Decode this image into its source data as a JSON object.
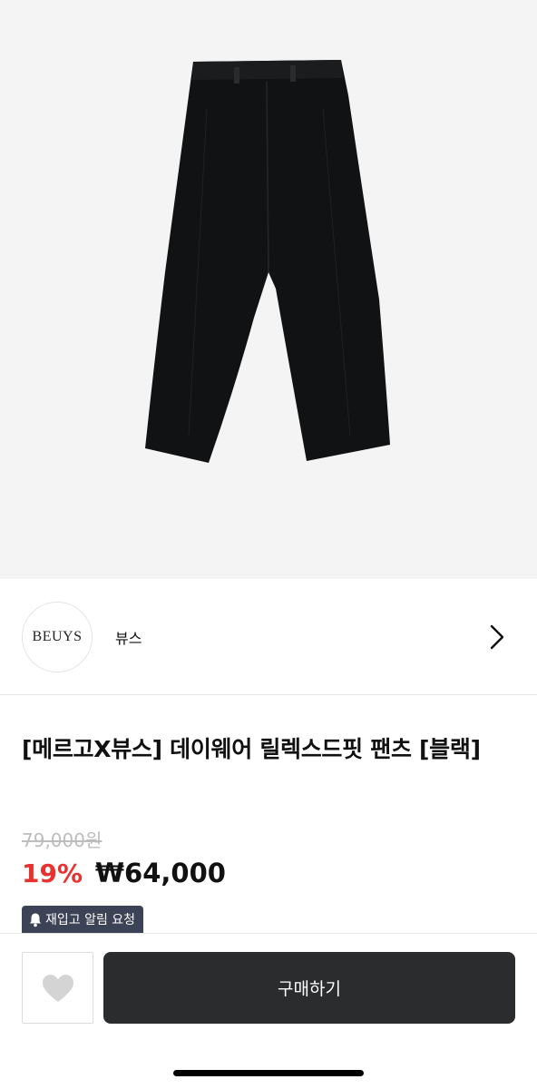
{
  "product_image": {
    "alt_icon": "pants-image"
  },
  "brand": {
    "logo_text": "BEUYS",
    "name": "뷰스"
  },
  "product": {
    "title": "[메르고X뷰스] 데이웨어 릴렉스드핏 팬츠 [블랙]",
    "original_price": "79,000원",
    "discount": "19%",
    "sale_price": "₩64,000"
  },
  "restock": {
    "label": "재입고 알림 요청"
  },
  "actions": {
    "buy_label": "구매하기"
  },
  "colors": {
    "discount_red": "#e8322f",
    "buy_button": "#2b2c2e",
    "restock_badge": "#3c4356",
    "hero_bg": "#f4f4f4"
  }
}
